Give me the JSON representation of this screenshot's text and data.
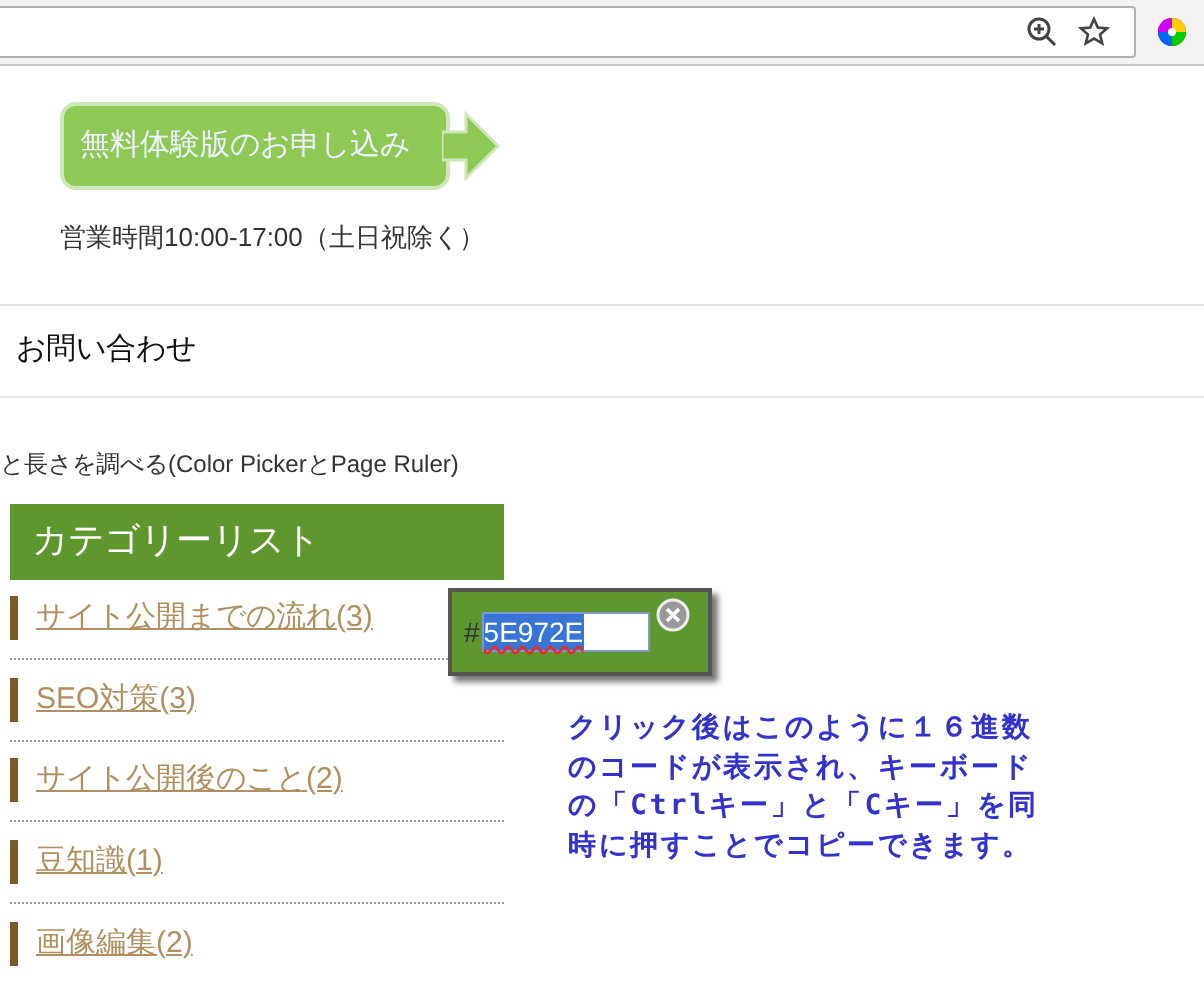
{
  "cta_button": {
    "label": "無料体験版のお申し込み"
  },
  "business_hours": "営業時間10:00-17:00（土日祝除く）",
  "nav_link": "お問い合わせ",
  "article_title": "と長さを調べる(Color PickerとPage Ruler)",
  "category_list": {
    "title": "カテゴリーリスト",
    "items": [
      "サイト公開までの流れ(3)",
      "SEO対策(3)",
      "サイト公開後のこと(2)",
      "豆知識(1)",
      "画像編集(2)"
    ]
  },
  "color_picker_popup": {
    "prefix": "#",
    "value": "5E972E"
  },
  "annotation": "クリック後はこのように１６進数のコードが表示され、キーボードの「Ctrlキー」と「Cキー」を同時に押すことでコピーできます。"
}
